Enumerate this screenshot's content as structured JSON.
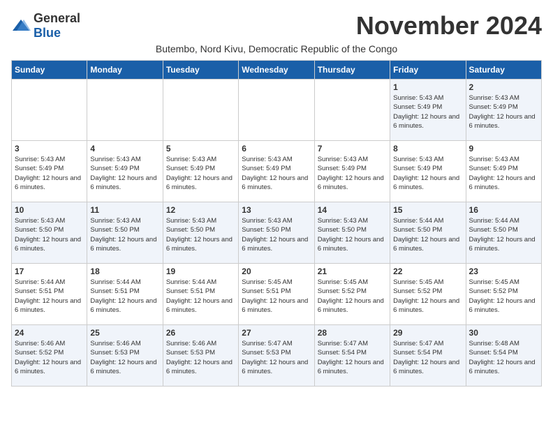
{
  "logo": {
    "general": "General",
    "blue": "Blue"
  },
  "title": "November 2024",
  "subtitle": "Butembo, Nord Kivu, Democratic Republic of the Congo",
  "days_of_week": [
    "Sunday",
    "Monday",
    "Tuesday",
    "Wednesday",
    "Thursday",
    "Friday",
    "Saturday"
  ],
  "weeks": [
    [
      {
        "day": "",
        "info": ""
      },
      {
        "day": "",
        "info": ""
      },
      {
        "day": "",
        "info": ""
      },
      {
        "day": "",
        "info": ""
      },
      {
        "day": "",
        "info": ""
      },
      {
        "day": "1",
        "info": "Sunrise: 5:43 AM\nSunset: 5:49 PM\nDaylight: 12 hours and 6 minutes."
      },
      {
        "day": "2",
        "info": "Sunrise: 5:43 AM\nSunset: 5:49 PM\nDaylight: 12 hours and 6 minutes."
      }
    ],
    [
      {
        "day": "3",
        "info": "Sunrise: 5:43 AM\nSunset: 5:49 PM\nDaylight: 12 hours and 6 minutes."
      },
      {
        "day": "4",
        "info": "Sunrise: 5:43 AM\nSunset: 5:49 PM\nDaylight: 12 hours and 6 minutes."
      },
      {
        "day": "5",
        "info": "Sunrise: 5:43 AM\nSunset: 5:49 PM\nDaylight: 12 hours and 6 minutes."
      },
      {
        "day": "6",
        "info": "Sunrise: 5:43 AM\nSunset: 5:49 PM\nDaylight: 12 hours and 6 minutes."
      },
      {
        "day": "7",
        "info": "Sunrise: 5:43 AM\nSunset: 5:49 PM\nDaylight: 12 hours and 6 minutes."
      },
      {
        "day": "8",
        "info": "Sunrise: 5:43 AM\nSunset: 5:49 PM\nDaylight: 12 hours and 6 minutes."
      },
      {
        "day": "9",
        "info": "Sunrise: 5:43 AM\nSunset: 5:49 PM\nDaylight: 12 hours and 6 minutes."
      }
    ],
    [
      {
        "day": "10",
        "info": "Sunrise: 5:43 AM\nSunset: 5:50 PM\nDaylight: 12 hours and 6 minutes."
      },
      {
        "day": "11",
        "info": "Sunrise: 5:43 AM\nSunset: 5:50 PM\nDaylight: 12 hours and 6 minutes."
      },
      {
        "day": "12",
        "info": "Sunrise: 5:43 AM\nSunset: 5:50 PM\nDaylight: 12 hours and 6 minutes."
      },
      {
        "day": "13",
        "info": "Sunrise: 5:43 AM\nSunset: 5:50 PM\nDaylight: 12 hours and 6 minutes."
      },
      {
        "day": "14",
        "info": "Sunrise: 5:43 AM\nSunset: 5:50 PM\nDaylight: 12 hours and 6 minutes."
      },
      {
        "day": "15",
        "info": "Sunrise: 5:44 AM\nSunset: 5:50 PM\nDaylight: 12 hours and 6 minutes."
      },
      {
        "day": "16",
        "info": "Sunrise: 5:44 AM\nSunset: 5:50 PM\nDaylight: 12 hours and 6 minutes."
      }
    ],
    [
      {
        "day": "17",
        "info": "Sunrise: 5:44 AM\nSunset: 5:51 PM\nDaylight: 12 hours and 6 minutes."
      },
      {
        "day": "18",
        "info": "Sunrise: 5:44 AM\nSunset: 5:51 PM\nDaylight: 12 hours and 6 minutes."
      },
      {
        "day": "19",
        "info": "Sunrise: 5:44 AM\nSunset: 5:51 PM\nDaylight: 12 hours and 6 minutes."
      },
      {
        "day": "20",
        "info": "Sunrise: 5:45 AM\nSunset: 5:51 PM\nDaylight: 12 hours and 6 minutes."
      },
      {
        "day": "21",
        "info": "Sunrise: 5:45 AM\nSunset: 5:52 PM\nDaylight: 12 hours and 6 minutes."
      },
      {
        "day": "22",
        "info": "Sunrise: 5:45 AM\nSunset: 5:52 PM\nDaylight: 12 hours and 6 minutes."
      },
      {
        "day": "23",
        "info": "Sunrise: 5:45 AM\nSunset: 5:52 PM\nDaylight: 12 hours and 6 minutes."
      }
    ],
    [
      {
        "day": "24",
        "info": "Sunrise: 5:46 AM\nSunset: 5:52 PM\nDaylight: 12 hours and 6 minutes."
      },
      {
        "day": "25",
        "info": "Sunrise: 5:46 AM\nSunset: 5:53 PM\nDaylight: 12 hours and 6 minutes."
      },
      {
        "day": "26",
        "info": "Sunrise: 5:46 AM\nSunset: 5:53 PM\nDaylight: 12 hours and 6 minutes."
      },
      {
        "day": "27",
        "info": "Sunrise: 5:47 AM\nSunset: 5:53 PM\nDaylight: 12 hours and 6 minutes."
      },
      {
        "day": "28",
        "info": "Sunrise: 5:47 AM\nSunset: 5:54 PM\nDaylight: 12 hours and 6 minutes."
      },
      {
        "day": "29",
        "info": "Sunrise: 5:47 AM\nSunset: 5:54 PM\nDaylight: 12 hours and 6 minutes."
      },
      {
        "day": "30",
        "info": "Sunrise: 5:48 AM\nSunset: 5:54 PM\nDaylight: 12 hours and 6 minutes."
      }
    ]
  ]
}
